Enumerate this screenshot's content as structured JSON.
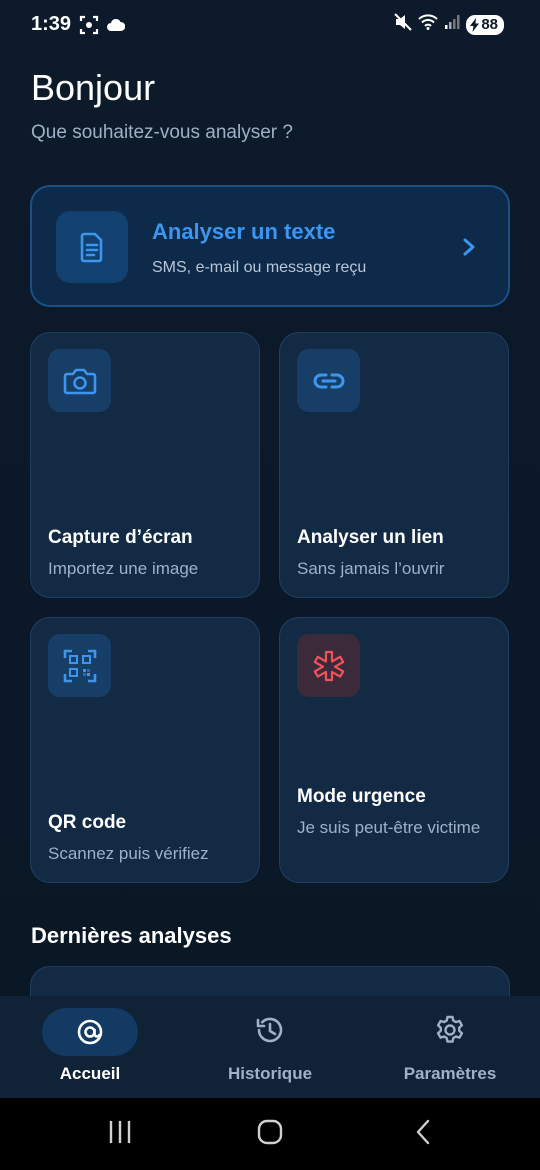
{
  "status_bar": {
    "time": "1:39",
    "battery": "88",
    "icons": [
      "screenshot-icon",
      "cloud-icon",
      "mute-icon",
      "wifi-icon",
      "signal-icon",
      "battery-charging-icon"
    ]
  },
  "header": {
    "greeting": "Bonjour",
    "subtitle": "Que souhaitez-vous analyser ?"
  },
  "primary_action": {
    "title": "Analyser un texte",
    "subtitle": "SMS, e-mail ou message reçu",
    "icon": "document-icon"
  },
  "actions": [
    {
      "title": "Capture d’écran",
      "subtitle": "Importez une image",
      "icon": "camera-icon"
    },
    {
      "title": "Analyser un lien",
      "subtitle": "Sans jamais l’ouvrir",
      "icon": "link-icon"
    },
    {
      "title": "QR code",
      "subtitle": "Scannez puis vérifiez",
      "icon": "qr-code-icon"
    },
    {
      "title": "Mode urgence",
      "subtitle": "Je suis peut-être victime",
      "icon": "emergency-icon"
    }
  ],
  "recent": {
    "title": "Dernières analyses"
  },
  "bottom_nav": {
    "items": [
      {
        "label": "Accueil",
        "icon": "home-at-icon",
        "active": true
      },
      {
        "label": "Historique",
        "icon": "history-icon",
        "active": false
      },
      {
        "label": "Paramètres",
        "icon": "gear-icon",
        "active": false
      }
    ]
  },
  "colors": {
    "accent": "#3d95ee",
    "background": "#0b1a2c",
    "card": "#132a45",
    "emergency": "#f0525a"
  }
}
